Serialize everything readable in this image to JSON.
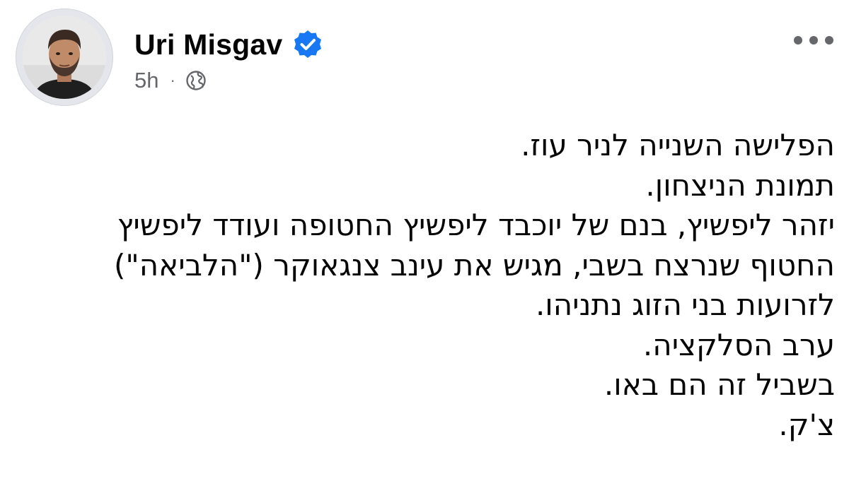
{
  "author": {
    "name": "Uri Misgav",
    "verified": true,
    "avatar_icon": "profile-photo-man-beard"
  },
  "meta": {
    "timestamp": "5h",
    "separator": "·",
    "audience_icon": "globe-icon"
  },
  "more_menu_icon": "more-horizontal-icon",
  "post": {
    "lines": [
      "הפלישה השנייה לניר עוז.",
      "תמונת הניצחון.",
      "יזהר ליפשיץ, בנם של יוכבד ליפשיץ החטופה ועודד ליפשיץ",
      "החטוף שנרצח בשבי, מגיש את עינב צנגאוקר (\"הלביאה\")",
      "לזרועות בני הזוג נתניהו.",
      "ערב הסלקציה.",
      "בשביל זה הם באו.",
      "צ'ק."
    ]
  },
  "colors": {
    "verified_blue": "#1877f2",
    "secondary_text": "#65676b",
    "primary_text": "#050505"
  }
}
